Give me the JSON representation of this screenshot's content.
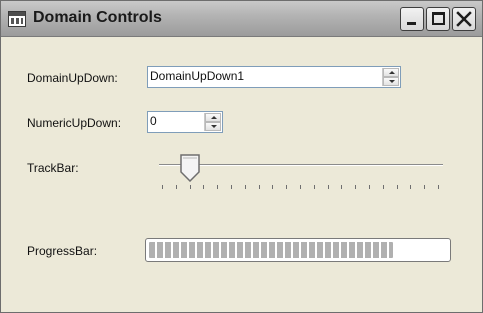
{
  "window": {
    "title": "Domain Controls",
    "icon": "form-icon",
    "controls": [
      "minimize-icon",
      "maximize-icon",
      "close-icon"
    ]
  },
  "domain_updown": {
    "label": "DomainUpDown:",
    "value": "DomainUpDown1"
  },
  "numeric_updown": {
    "label": "NumericUpDown:",
    "value": "0"
  },
  "trackbar": {
    "label": "TrackBar:",
    "value": 2,
    "min": 0,
    "max": 20
  },
  "progressbar": {
    "label": "ProgressBar:",
    "percent": 82
  }
}
